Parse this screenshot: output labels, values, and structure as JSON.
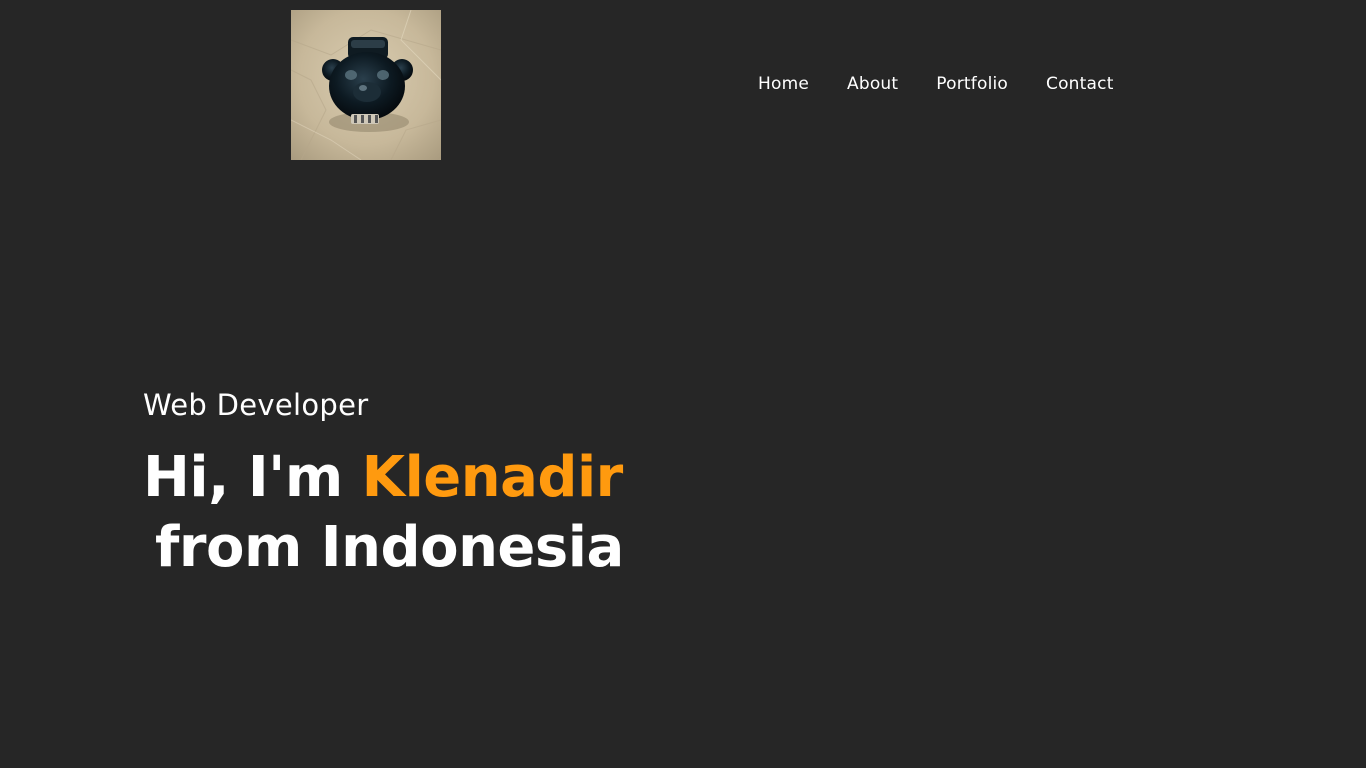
{
  "header": {
    "logo_alt": "bear figurine photo",
    "nav": [
      {
        "label": "Home"
      },
      {
        "label": "About"
      },
      {
        "label": "Portfolio"
      },
      {
        "label": "Contact"
      }
    ]
  },
  "hero": {
    "subtitle": "Web Developer",
    "greeting": "Hi, I'm ",
    "name": "Klenadir",
    "line2": "from Indonesia"
  },
  "colors": {
    "background": "#262626",
    "text": "#ffffff",
    "accent": "#ff9a0f"
  }
}
